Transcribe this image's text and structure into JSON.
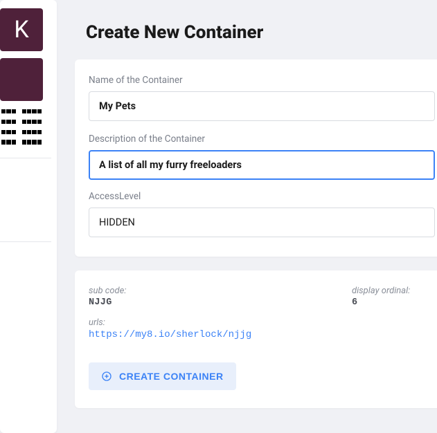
{
  "sidebar": {
    "tile1_letter": "K"
  },
  "page": {
    "title": "Create New Container"
  },
  "form": {
    "name_label": "Name of the Container",
    "name_value": "My Pets",
    "desc_label": "Description of the Container",
    "desc_value": "A list of all my furry freeloaders",
    "access_label": "AccessLevel",
    "access_value": "HIDDEN"
  },
  "meta": {
    "subcode_label": "sub code:",
    "subcode_value": "NJJG",
    "ordinal_label": "display ordinal:",
    "ordinal_value": "6",
    "urls_label": "urls:",
    "url_value": "https://my8.io/sherlock/njjg"
  },
  "action": {
    "create_label": "CREATE CONTAINER"
  }
}
